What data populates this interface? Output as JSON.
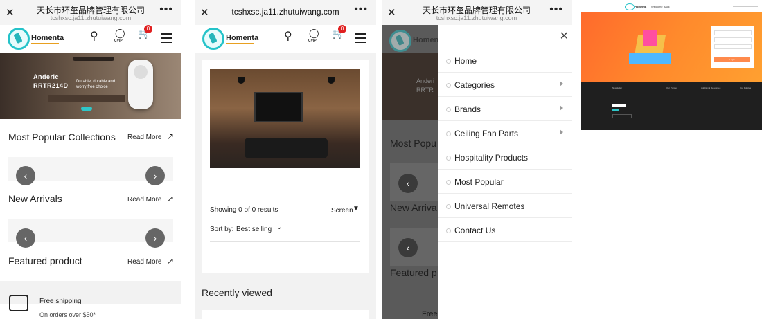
{
  "screen1": {
    "title": "天长市环玺品牌管理有限公司",
    "url": "tcshxsc.ja11.zhutuiwang.com",
    "brand": "Homenta",
    "cart_count": "0",
    "account_label": "CVIP",
    "hero": {
      "brand": "Anderic",
      "model": "RRTR214D",
      "tagline": "Durable, durable and worry free choice"
    },
    "sections": {
      "popular": "Most Popular Collections",
      "new": "New Arrivals",
      "featured": "Featured product",
      "read_more": "Read More"
    },
    "shipping": {
      "title": "Free shipping",
      "sub": "On orders over $50*"
    }
  },
  "screen2": {
    "url": "tcshxsc.ja11.zhutuiwang.com",
    "brand": "Homenta",
    "cart_count": "0",
    "account_label": "CVIP",
    "showing": "Showing 0 of 0 results",
    "screen_label": "Screen",
    "sort_label": "Sort by:",
    "sort_value": "Best selling",
    "recently_viewed": "Recently viewed"
  },
  "screen3": {
    "title": "天长市环玺品牌管理有限公司",
    "url": "tcshxsc.ja11.zhutuiwang.com",
    "brand": "Homenta",
    "menu": [
      {
        "label": "Home",
        "sub": false
      },
      {
        "label": "Categories",
        "sub": true
      },
      {
        "label": "Brands",
        "sub": true
      },
      {
        "label": "Ceiling Fan Parts",
        "sub": true
      },
      {
        "label": "Hospitality Products",
        "sub": false
      },
      {
        "label": "Most Popular",
        "sub": false
      },
      {
        "label": "Universal Remotes",
        "sub": false
      },
      {
        "label": "Contact Us",
        "sub": false
      }
    ],
    "ghost": {
      "brand_line1": "Anderi",
      "brand_line2": "RRTR",
      "popular": "Most Popu",
      "new": "New Arriva",
      "featured": "Featured p",
      "free": "Free"
    }
  },
  "screen4": {
    "brand": "Homenta",
    "welcome": "Welcome Back",
    "footer_cols": [
      "Newsletter",
      "Our Policies",
      "Additional Resources",
      "Our Policies"
    ],
    "login": "Login"
  }
}
